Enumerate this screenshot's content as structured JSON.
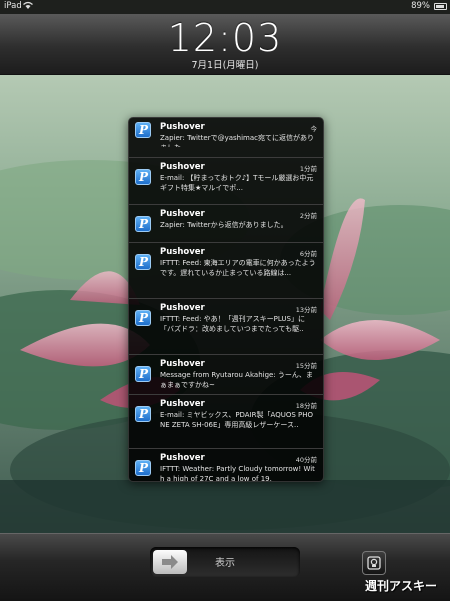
{
  "status_bar": {
    "carrier": "iPad",
    "battery_percent": "89%"
  },
  "lock_screen": {
    "time": "12:03",
    "date": "7月1日(月曜日)"
  },
  "notifications": [
    {
      "app": "Pushover",
      "time": "今",
      "body": "Zapier: Twitterで@yashimac宛てに返信がありました。"
    },
    {
      "app": "Pushover",
      "time": "1分前",
      "body": "E-mail: 【貯まっておトク♪】Tモール厳選お中元ギフト特集★マルイでポ..."
    },
    {
      "app": "Pushover",
      "time": "2分前",
      "body": "Zapier: Twitterから返信がありました。"
    },
    {
      "app": "Pushover",
      "time": "6分前",
      "body": "IFTTT: Feed: 東海エリアの電車に何かあったようです。遅れているか止まっている路線は..."
    },
    {
      "app": "Pushover",
      "time": "13分前",
      "body": "IFTTT: Feed: やあ！「週刊アスキーPLUS」に「バズドラ：改めましていつまでたっても駆.."
    },
    {
      "app": "Pushover",
      "time": "15分前",
      "body": "Message from Ryutarou Akahige: うーん、まぁまぁですかね~"
    },
    {
      "app": "Pushover",
      "time": "18分前",
      "body": "E-mail: ミヤビックス、PDAIR製「AQUOS PHONE ZETA SH-06E」専用高級レザーケース.."
    },
    {
      "app": "Pushover",
      "time": "40分前",
      "body": "IFTTT: Weather: Partly Cloudy tomorrow! With a high of 27C and a low of 19."
    }
  ],
  "unlock": {
    "label": "表示"
  },
  "watermark": "週刊アスキー",
  "colors": {
    "icon_blue": "#2d86e0",
    "bar_dark": "#1c1c1c",
    "petal_pink": "#d98aa3"
  }
}
